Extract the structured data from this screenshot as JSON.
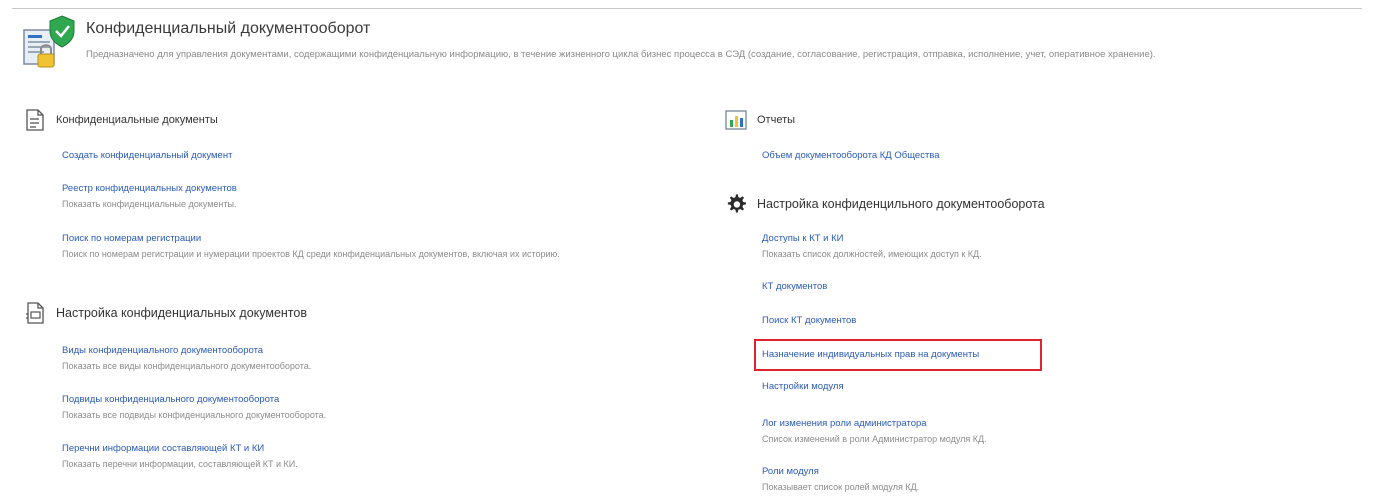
{
  "header": {
    "title": "Конфиденциальный документооборот",
    "description": "Предназначено для управления документами, содержащими конфиденциальную информацию, в течение жизненного цикла бизнес процесса в СЭД (создание, согласование, регистрация, отправка, исполнение, учет, оперативное хранение)."
  },
  "left": {
    "section1": {
      "title": "Конфиденциальные документы",
      "items": [
        {
          "label": "Создать конфиденциальный документ",
          "desc": ""
        },
        {
          "label": "Реестр конфиденциальных документов",
          "desc": "Показать конфиденциальные документы."
        },
        {
          "label": "Поиск по номерам регистрации",
          "desc": "Поиск по номерам регистрации и нумерации проектов КД среди конфиденциальных документов, включая их историю."
        }
      ]
    },
    "section2": {
      "title": "Настройка конфиденциальных документов",
      "items": [
        {
          "label": "Виды конфиденциального документооборота",
          "desc": "Показать все виды конфиденциального документооборота."
        },
        {
          "label": "Подвиды конфиденциального документооборота",
          "desc": "Показать все подвиды конфиденциального документооборота."
        },
        {
          "label": "Перечни информации составляющей КТ и КИ",
          "desc": "Показать перечни информации, составляющей КТ и КИ."
        }
      ]
    }
  },
  "right": {
    "section1": {
      "title": "Отчеты",
      "items": [
        {
          "label": "Объем документооборота КД Общества",
          "desc": ""
        }
      ]
    },
    "section2": {
      "title": "Настройка конфиденцильного документооборота",
      "items": [
        {
          "label": "Доступы к КТ и КИ",
          "desc": "Показать список должностей, имеющих доступ к КД."
        },
        {
          "label": "КТ документов",
          "desc": ""
        },
        {
          "label": "Поиск КТ документов",
          "desc": ""
        },
        {
          "label": "Назначение индивидуальных прав на документы",
          "desc": ""
        },
        {
          "label": "Настройки модуля",
          "desc": ""
        },
        {
          "label": "Лог изменения роли администратора",
          "desc": "Список изменений в роли Администратор модуля КД."
        },
        {
          "label": "Роли модуля",
          "desc": "Показывает список ролей модуля КД."
        }
      ]
    }
  },
  "colors": {
    "link": "#2a5bb5",
    "highlight": "#e0242e",
    "shield": "#2fa84f"
  },
  "icons": {
    "header": "confidential-doc-shield-icon",
    "left_section1": "document-list-icon",
    "left_section2": "document-settings-icon",
    "right_section1": "report-chart-icon",
    "right_section2": "gear-icon"
  }
}
